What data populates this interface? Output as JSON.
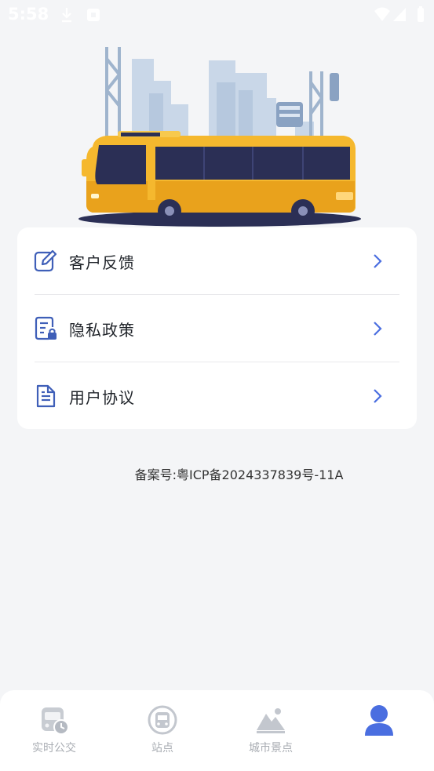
{
  "status_bar": {
    "time": "5:58"
  },
  "menu": {
    "items": [
      {
        "label": "客户反馈",
        "icon": "edit-icon"
      },
      {
        "label": "隐私政策",
        "icon": "privacy-lock-icon"
      },
      {
        "label": "用户协议",
        "icon": "document-icon"
      }
    ]
  },
  "footer": {
    "icp": "备案号:粤ICP备2024337839号-11A"
  },
  "tabbar": {
    "tabs": [
      {
        "label": "实时公交",
        "icon": "realtime-bus-icon"
      },
      {
        "label": "站点",
        "icon": "bus-stop-icon"
      },
      {
        "label": "城市景点",
        "icon": "mountain-scenery-icon"
      },
      {
        "label": "",
        "icon": "user-profile-icon",
        "active": true
      }
    ]
  },
  "colors": {
    "accent": "#4a6ee0",
    "bus_yellow": "#f5b82e",
    "tab_inactive": "#a9adb3",
    "icon_blue": "#3f5fb8"
  }
}
